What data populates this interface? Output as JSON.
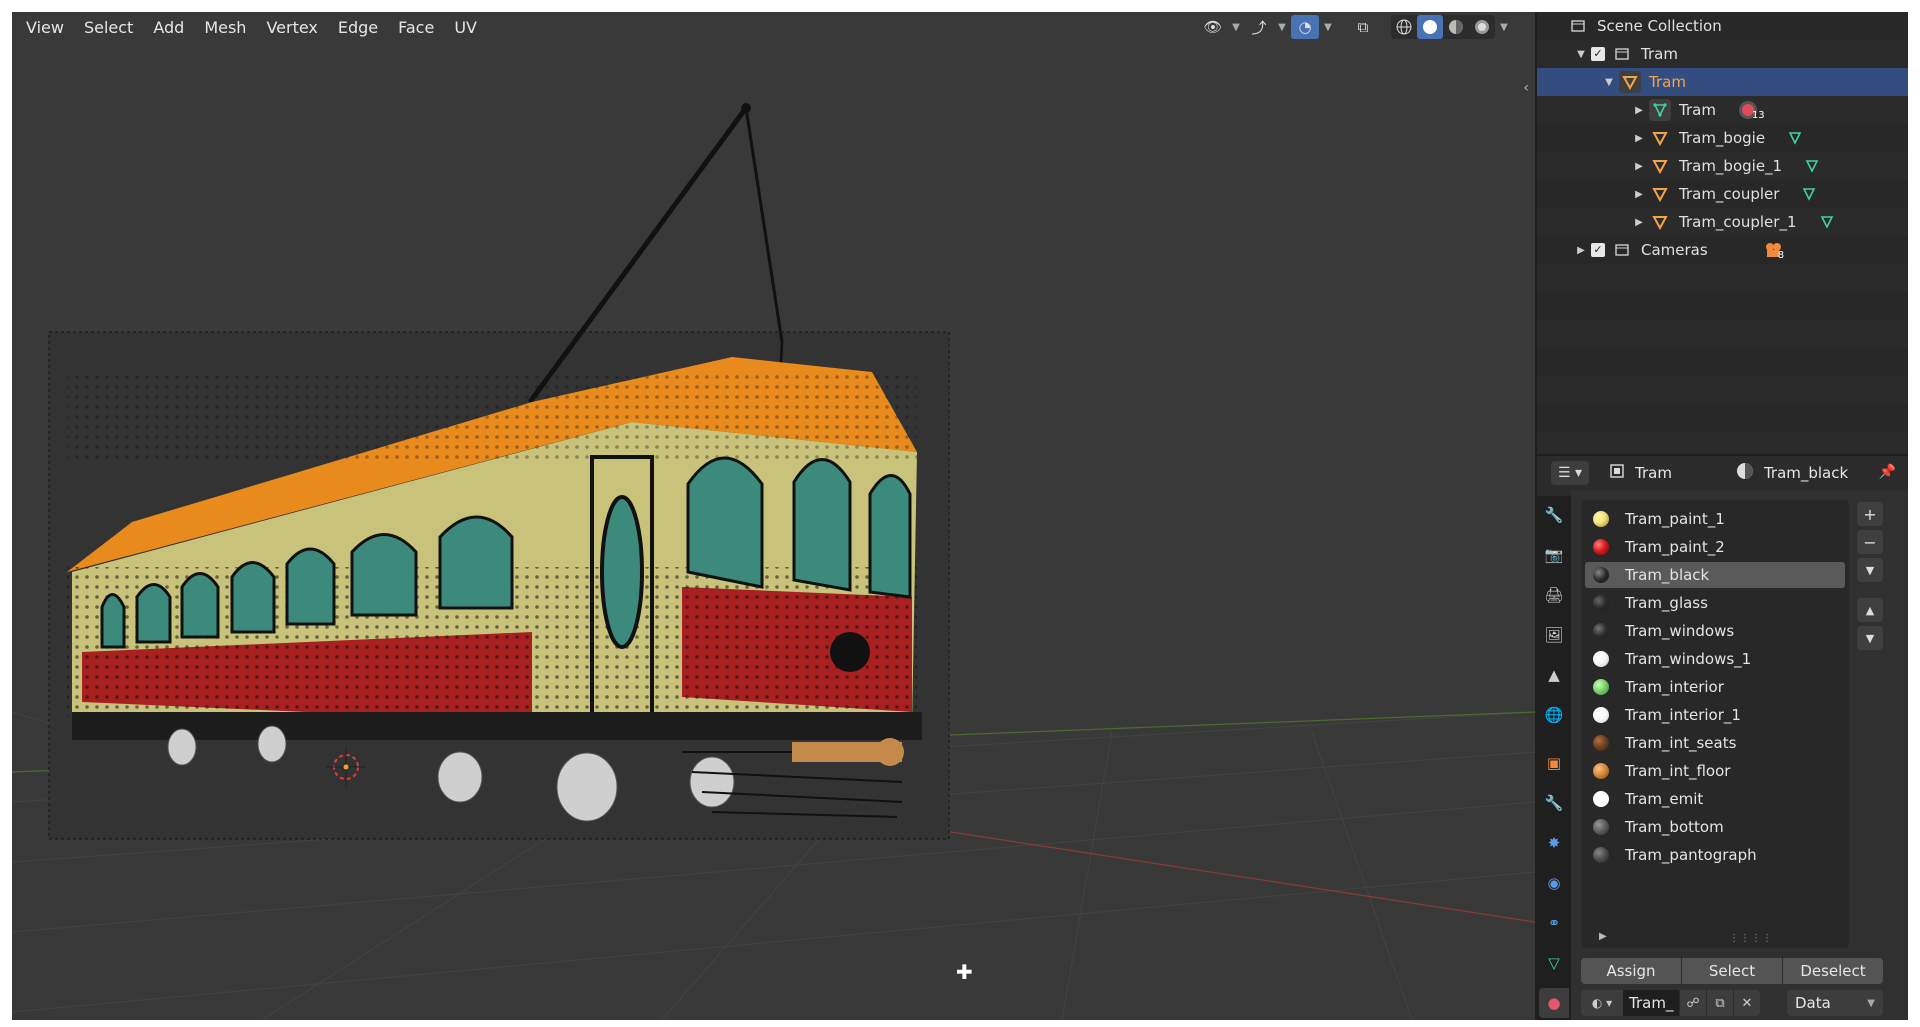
{
  "viewport": {
    "menu": [
      "View",
      "Select",
      "Add",
      "Mesh",
      "Vertex",
      "Edge",
      "Face",
      "UV"
    ]
  },
  "outliner": {
    "rows": [
      {
        "label": "Scene Collection",
        "icon": "scene-collection-icon"
      },
      {
        "label": "Tram",
        "icon": "collection-icon",
        "expanded": true,
        "checked": true
      },
      {
        "label": "Tram",
        "icon": "mesh-object-icon",
        "selected": true
      },
      {
        "label": "Tram",
        "icon": "mesh-data-icon",
        "badge": "13"
      },
      {
        "label": "Tram_bogie",
        "icon": "mesh-object-icon"
      },
      {
        "label": "Tram_bogie_1",
        "icon": "mesh-object-icon"
      },
      {
        "label": "Tram_coupler",
        "icon": "mesh-object-icon"
      },
      {
        "label": "Tram_coupler_1",
        "icon": "mesh-object-icon"
      },
      {
        "label": "Cameras",
        "icon": "collection-icon",
        "checked": true,
        "badge": "8"
      }
    ]
  },
  "properties": {
    "breadcrumb": {
      "object": "Tram",
      "material": "Tram_black"
    },
    "material_slots": [
      {
        "name": "Tram_paint_1",
        "color": "#f0e27a"
      },
      {
        "name": "Tram_paint_2",
        "color": "#d81c1c"
      },
      {
        "name": "Tram_black",
        "color": "#2a2a2a",
        "selected": true
      },
      {
        "name": "Tram_glass",
        "color": "#444444"
      },
      {
        "name": "Tram_windows",
        "color": "#2d2d2d"
      },
      {
        "name": "Tram_windows_1",
        "color": "#f4f4f4"
      },
      {
        "name": "Tram_interior",
        "color": "#7ed36a"
      },
      {
        "name": "Tram_interior_1",
        "color": "#f8f8f8"
      },
      {
        "name": "Tram_int_seats",
        "color": "#6b3d1f"
      },
      {
        "name": "Tram_int_floor",
        "color": "#d88a3c"
      },
      {
        "name": "Tram_emit",
        "color": "#ffffff"
      },
      {
        "name": "Tram_bottom",
        "color": "#5a5a5a"
      },
      {
        "name": "Tram_pantograph",
        "color": "#4a4a4a"
      }
    ],
    "actions": {
      "assign": "Assign",
      "select": "Select",
      "deselect": "Deselect"
    },
    "material_field": "Tram_",
    "link_mode": "Data"
  }
}
